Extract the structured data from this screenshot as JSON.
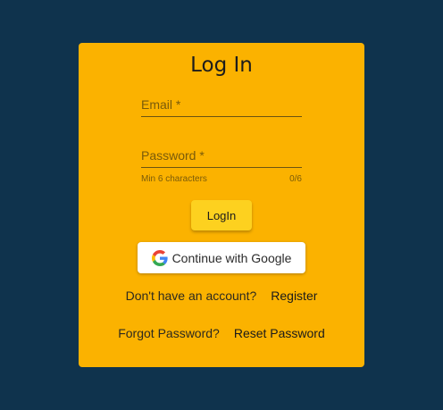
{
  "colors": {
    "background": "#0f334d",
    "card": "#fbb200",
    "login_button": "#fdd11f"
  },
  "login": {
    "title": "Log In",
    "email_label": "Email *",
    "password_label": "Password *",
    "password_helper": "Min 6 characters",
    "password_counter": "0/6",
    "login_button": "LogIn",
    "google_button": "Continue with Google",
    "google_icon": "google-g-logo",
    "register_prompt": "Don't have an account?",
    "register_link": "Register",
    "forgot_prompt": "Forgot Password?",
    "reset_link": "Reset Password"
  }
}
